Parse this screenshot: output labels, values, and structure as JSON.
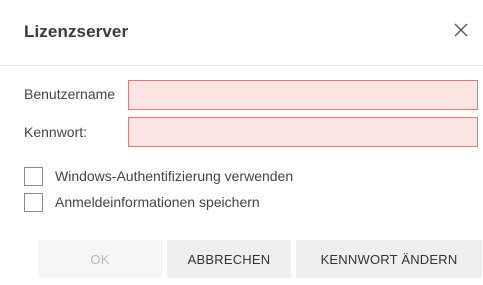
{
  "dialog": {
    "title": "Lizenzserver",
    "close_icon": "close-icon"
  },
  "form": {
    "username_label": "Benutzername",
    "username_value": "",
    "password_label": "Kennwort:",
    "password_value": ""
  },
  "options": {
    "windows_auth_label": "Windows-Authentifizierung verwenden",
    "windows_auth_checked": false,
    "save_credentials_label": "Anmeldeinformationen speichern",
    "save_credentials_checked": false
  },
  "buttons": {
    "ok_label": "OK",
    "ok_disabled": true,
    "cancel_label": "ABBRECHEN",
    "change_password_label": "KENNWORT ÄNDERN"
  },
  "colors": {
    "invalid_field_background": "#fde3e1",
    "invalid_field_border": "#e07a7a",
    "button_background": "#efefef"
  }
}
